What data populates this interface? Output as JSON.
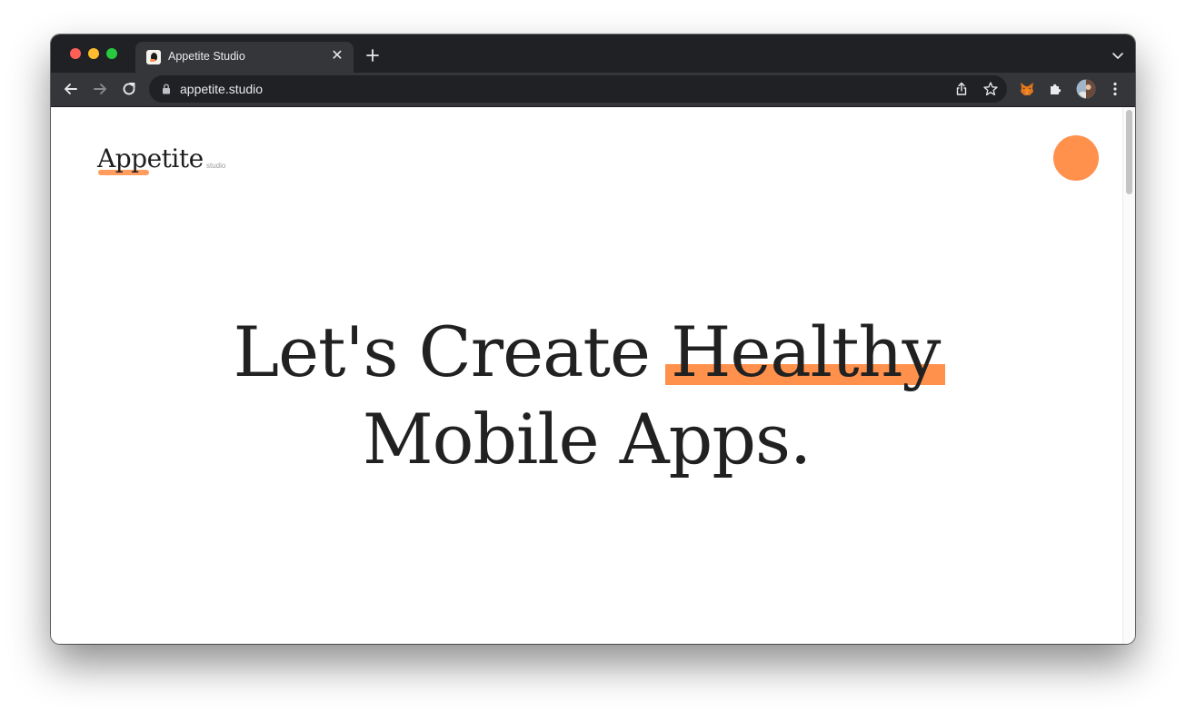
{
  "browser": {
    "tab": {
      "title": "Appetite Studio",
      "close_label": "✕"
    },
    "address_bar": {
      "url": "appetite.studio"
    },
    "icons": {
      "back": "back-arrow-icon",
      "forward": "forward-arrow-icon",
      "reload": "reload-icon",
      "lock": "lock-icon",
      "share": "share-icon",
      "bookmark": "star-icon",
      "extension_fox": "metamask-fox-icon",
      "extensions": "puzzle-icon",
      "profile": "avatar",
      "menu": "more-vertical-icon",
      "new_tab": "plus-icon",
      "tab_search": "chevron-down-icon"
    },
    "colors": {
      "chrome_dark": "#202124",
      "chrome_mid": "#35363a"
    }
  },
  "site": {
    "logo": {
      "wordmark": "Appetite",
      "suffix": "studio"
    },
    "hero": {
      "line1_prefix": "Let's Create ",
      "line1_highlight": "Healthy",
      "line2": "Mobile Apps."
    },
    "colors": {
      "accent": "#ff914d",
      "text": "#212121"
    }
  }
}
